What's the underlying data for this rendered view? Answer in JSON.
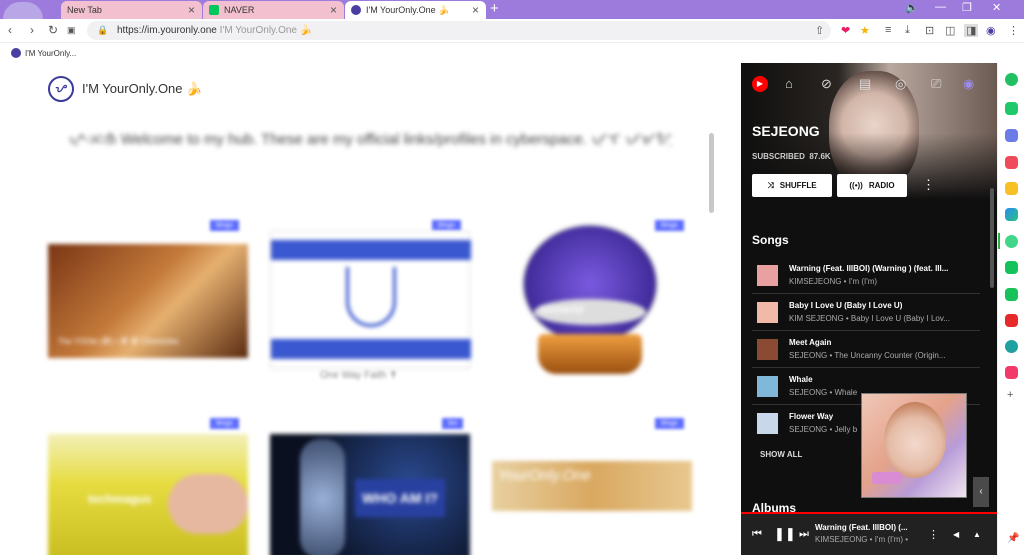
{
  "browser": {
    "tabs": [
      {
        "label": "New Tab",
        "favicon_color": "#ffffff"
      },
      {
        "label": "NAVER",
        "favicon_color": "#03c75a"
      },
      {
        "label": "I'M YourOnly.One 🍌",
        "favicon_color": "#4a3ea0"
      }
    ],
    "new_tab_symbol": "+",
    "url": "https://im.youronly.one",
    "url_site_title": "I'M YourOnly.One 🍌",
    "bookmark_label": "I'M YourOnly..."
  },
  "page": {
    "title": "I'M YourOnly.One 🍌",
    "welcome": "ᜌᜓ-ᜁᜈᜒ Welcome to my hub. These are my official links/profiles in cyberspace. ᜉᜓᜎ ᜉᜋᜀᜓ",
    "cards": [
      {
        "badge": "blogs",
        "caption": "The YOOki (夢) • 夢 夢 Chronicles",
        "color": "#b45a2a"
      },
      {
        "badge": "blogs",
        "caption": "One Way Faith ✝",
        "color": "#3553c8"
      },
      {
        "badge": "blogs",
        "caption": "Snowrld",
        "color": "#3d2a8a"
      },
      {
        "badge": "blogs",
        "caption": "techmagus",
        "color": "#e5d64b"
      },
      {
        "badge": "bio",
        "caption": "WHO AM I?",
        "color": "#1f3a6e"
      },
      {
        "badge": "blogs",
        "caption": "YourOnly.One",
        "color": "#e0b86a"
      }
    ]
  },
  "yt": {
    "artist": "SEJEONG",
    "subscribed_label": "SUBSCRIBED",
    "subscribers": "87.6K",
    "shuffle_label": "SHUFFLE",
    "radio_label": "RADIO",
    "songs_heading": "Songs",
    "songs": [
      {
        "title": "Warning (Feat. lIlBOI) (Warning ) (feat. lIl...",
        "sub": "KIMSEJEONG • I'm (I'm)",
        "thumb": "#e8a0a0"
      },
      {
        "title": "Baby I Love U (Baby I Love U)",
        "sub": "KIM SEJEONG • Baby I Love U (Baby I Lov...",
        "thumb": "#f0b9a8"
      },
      {
        "title": "Meet Again",
        "sub": "SEJEONG • The Uncanny Counter (Origin...",
        "thumb": "#8a4a34"
      },
      {
        "title": "Whale",
        "sub": "SEJEONG • Whale",
        "thumb": "#7fb8d8"
      },
      {
        "title": "Flower Way",
        "sub": "SEJEONG • Jelly b",
        "thumb": "#c8d8ea"
      }
    ],
    "show_all": "SHOW ALL",
    "albums_heading": "Albums",
    "now_playing": {
      "title": "Warning (Feat. lIlBOI) (...",
      "sub": "KIMSEJEONG • I'm (I'm) •"
    }
  },
  "icons": [
    "youtube-music-icon",
    "home-icon",
    "explore-icon",
    "library-icon",
    "play-circle-icon",
    "cast-icon",
    "profile-icon"
  ]
}
